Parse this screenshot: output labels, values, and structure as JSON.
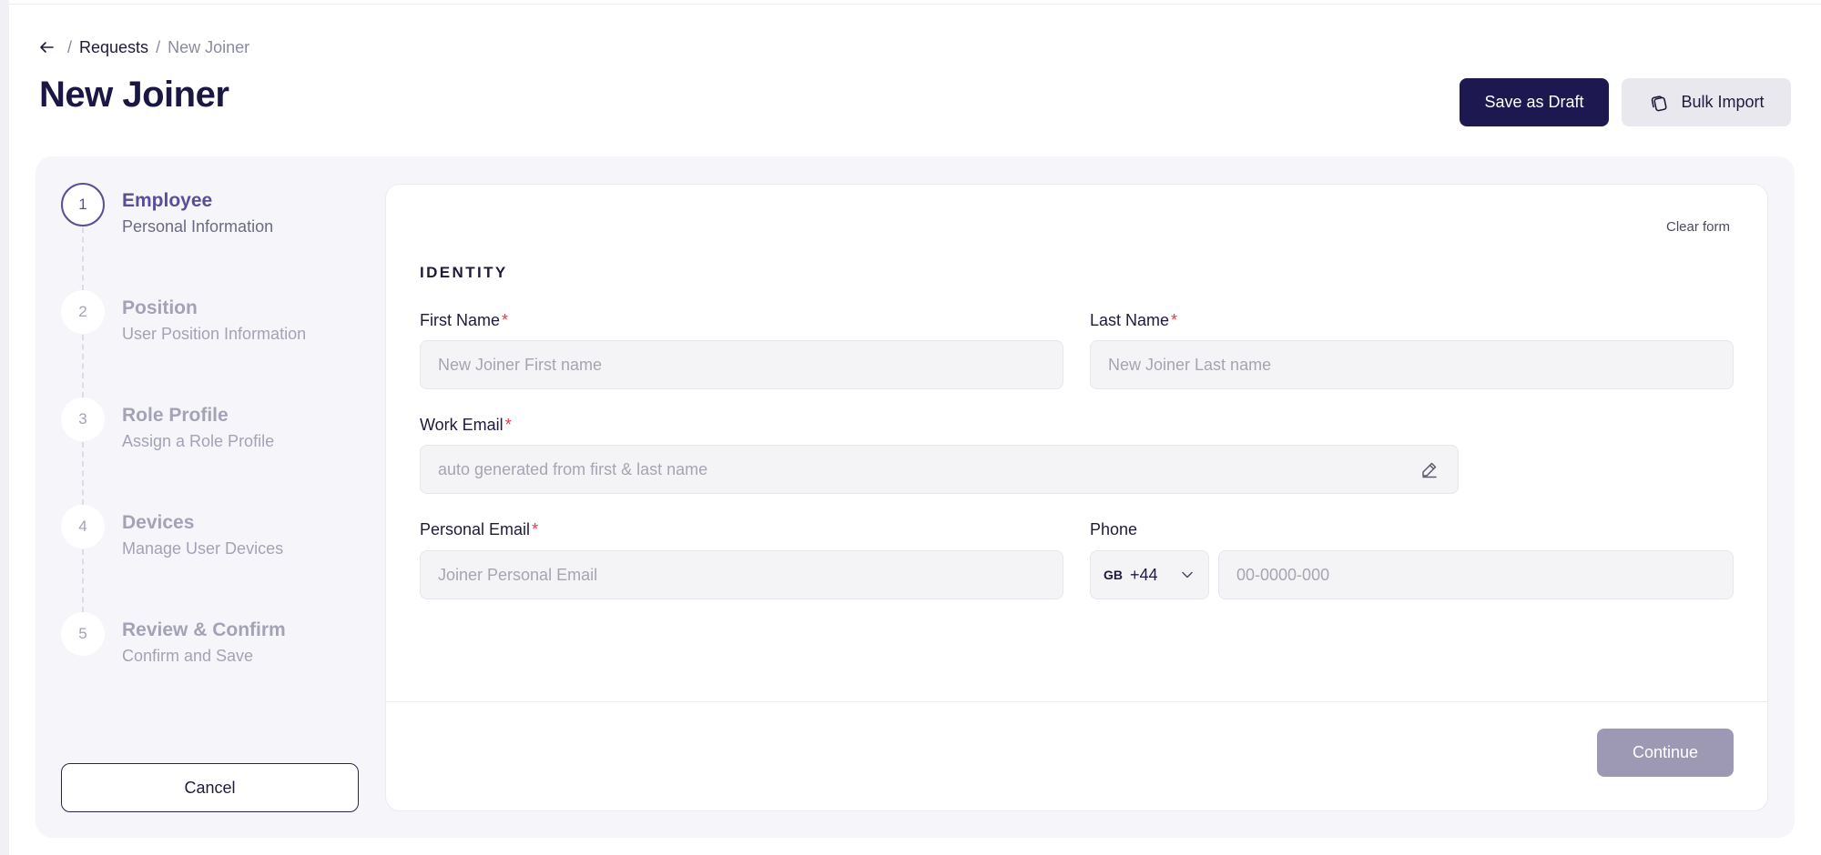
{
  "breadcrumb": {
    "separator": "/",
    "parent": "Requests",
    "current": "New Joiner"
  },
  "page_title": "New Joiner",
  "actions": {
    "save_draft": "Save as Draft",
    "bulk_import": "Bulk Import"
  },
  "steps": [
    {
      "number": "1",
      "title": "Employee",
      "subtitle": "Personal Information",
      "active": true
    },
    {
      "number": "2",
      "title": "Position",
      "subtitle": "User Position Information",
      "active": false
    },
    {
      "number": "3",
      "title": "Role Profile",
      "subtitle": "Assign a Role Profile",
      "active": false
    },
    {
      "number": "4",
      "title": "Devices",
      "subtitle": "Manage User Devices",
      "active": false
    },
    {
      "number": "5",
      "title": "Review & Confirm",
      "subtitle": "Confirm and Save",
      "active": false
    }
  ],
  "cancel_label": "Cancel",
  "form": {
    "clear_label": "Clear form",
    "section_title": "IDENTITY",
    "required_marker": "*",
    "first_name": {
      "label": "First Name",
      "placeholder": "New Joiner First name",
      "value": ""
    },
    "last_name": {
      "label": "Last Name",
      "placeholder": "New Joiner Last name",
      "value": ""
    },
    "work_email": {
      "label": "Work Email",
      "placeholder": "auto generated from first & last name",
      "value": ""
    },
    "personal_email": {
      "label": "Personal Email",
      "placeholder": "Joiner Personal Email",
      "value": ""
    },
    "phone": {
      "label": "Phone",
      "country": "GB",
      "dial_code": "+44",
      "placeholder": "00-0000-000",
      "value": ""
    }
  },
  "continue_label": "Continue",
  "colors": {
    "primary": "#1e1850",
    "accent": "#5a4f96",
    "required": "#e23b4a",
    "continue_disabled": "#9d98b3"
  },
  "icons": {
    "back": "arrow-left-icon",
    "bulk_import": "copy-stack-icon",
    "edit": "pencil-icon",
    "dropdown": "chevron-down-icon"
  }
}
